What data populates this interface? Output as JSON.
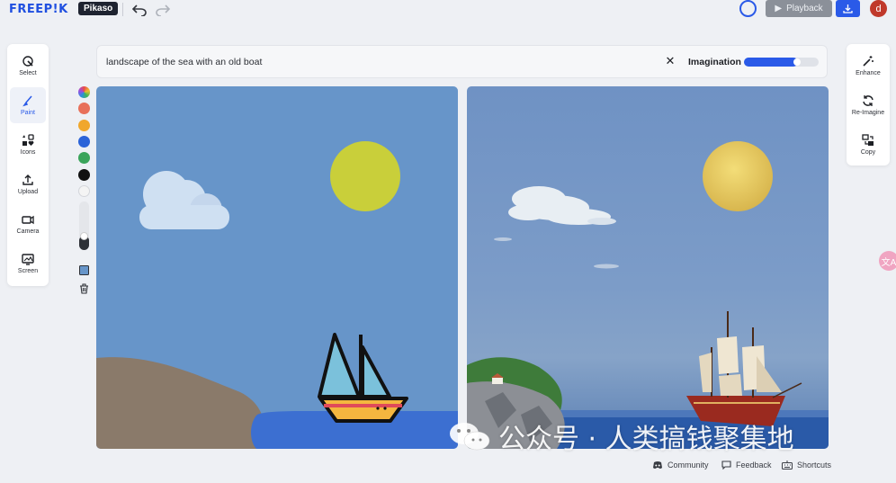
{
  "header": {
    "logo": "FREEP!K",
    "product": "Pikaso",
    "playback_label": "Playback",
    "avatar_letter": "d"
  },
  "left_tools": [
    {
      "label": "Select",
      "icon": "select-pointer-icon"
    },
    {
      "label": "Paint",
      "icon": "paint-brush-icon",
      "active": true
    },
    {
      "label": "Icons",
      "icon": "shapes-icon"
    },
    {
      "label": "Upload",
      "icon": "upload-icon"
    },
    {
      "label": "Camera",
      "icon": "camera-icon"
    },
    {
      "label": "Screen",
      "icon": "screen-capture-icon"
    }
  ],
  "right_tools": [
    {
      "label": "Enhance",
      "icon": "magic-wand-icon"
    },
    {
      "label": "Re-Imagine",
      "icon": "refresh-icon"
    },
    {
      "label": "Copy",
      "icon": "copy-icon"
    }
  ],
  "prompt": {
    "text": "landscape of the sea with an old boat",
    "imagination_label": "Imagination",
    "imagination_level": 0.68
  },
  "palette": {
    "colors": [
      "#e8705a",
      "#f0a72c",
      "#2b63d8",
      "#3aa45a",
      "#111111",
      "#f4f4f4"
    ],
    "brush_size": 0.3
  },
  "watermark": {
    "text": "公众号 · 人类搞钱聚集地"
  },
  "footer": {
    "community": "Community",
    "feedback": "Feedback",
    "shortcuts": "Shortcuts"
  },
  "colors": {
    "accent": "#2a5ae8",
    "sky_sketch": "#6795c9",
    "sun_sketch": "#c9cf3a",
    "sea_sketch": "#3c6fd1"
  }
}
